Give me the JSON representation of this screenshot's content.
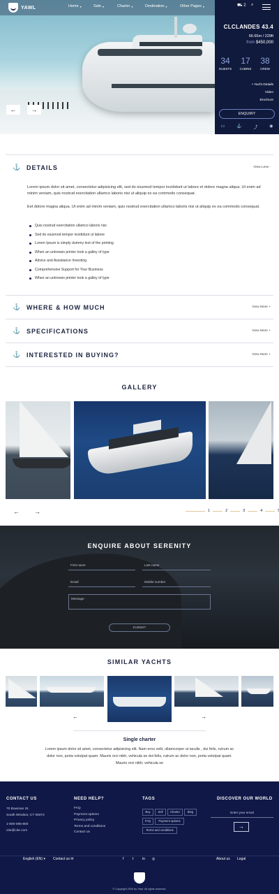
{
  "brand": {
    "name": "YAWL"
  },
  "nav": {
    "items": [
      {
        "label": "Home"
      },
      {
        "label": "Sale"
      },
      {
        "label": "Charter"
      },
      {
        "label": "Destination"
      },
      {
        "label": "Other Pages"
      }
    ],
    "cart_count": "2"
  },
  "hero_panel": {
    "title": "CLCLANDES 43.4",
    "dimensions": "66.65m / 229ft",
    "price_label": "from",
    "price": "$450,000",
    "stats": [
      {
        "value": "34",
        "label": "GUESTS"
      },
      {
        "value": "17",
        "label": "CABINS"
      },
      {
        "value": "38",
        "label": "CREW"
      }
    ],
    "links": [
      "• Yacht Details",
      "Video",
      "Brochure"
    ],
    "enquiry_label": "ENQUIRY"
  },
  "sections": {
    "details": {
      "title": "DETAILS",
      "toggle": "View Less -"
    },
    "where": {
      "title": "WHERE & HOW MUCH",
      "toggle": "View More +"
    },
    "specs": {
      "title": "SPECIFICATIONS",
      "toggle": "View More +"
    },
    "buying": {
      "title": "INTERESTED IN BUYING?",
      "toggle": "View More +"
    }
  },
  "details": {
    "paragraph1": "Lorem ipsum dolor sit amet, consectetur adipisicing elit, sed do eiusmod tempor incididunt ut labore et dolore magna aliqua. Ut enim ad minim veniam, quis nostrud exercitation ullamco laboris nisi ut aliquip ex ea commodo consequat.",
    "paragraph2": "Eet dolore magna aliqua. Ut enim ad minim veniam, quis nostrud exercitation ullamco laboris nisi ut aliquip ex ea commodo consequat.",
    "bullets": [
      "Quis nostrud exercitation ullamco laboris nisi",
      "Sed do eiusmod tempor incididunt ut labore",
      "Lorem Ipsum is simply dummy text of the printing",
      "When an unknown printer took a galley of type",
      "Advice and Assistance Investing",
      "Comprehensive Support for Your Business",
      "When an unknown printer took a galley of type"
    ]
  },
  "gallery": {
    "title": "GALLERY",
    "pages": [
      "1",
      "2",
      "3",
      "4",
      "5"
    ]
  },
  "enquire": {
    "title": "ENQUIRE ABOUT SERENITY",
    "first_name": "First name",
    "last_name": "Last name",
    "email": "Email",
    "mobile": "Mobile number",
    "message": "Message",
    "submit": "SUBMIT"
  },
  "similar": {
    "title": "SIMILAR YACHTS",
    "item_title": "Single charter",
    "item_desc": "Lorem ipsum dolor sit amet, consectetur adipisicing elit. Nam eros velit, ullamcorper ut iaculis , dui felis, rutrum ac dolor non, porta volutpat quam. Mauris orci nibh, vehicula se dui felis, rutrum ac dolor non, porta volutpat quam. Mauris orci nibh; vehicula se"
  },
  "footer": {
    "contact_title": "CONTACT US",
    "address1": "70 Bowman St.",
    "address2": "South Windsor, CT 06074",
    "phone": "1-800-085-800",
    "email": "cite@cite.com",
    "help_title": "NEED HELP?",
    "help_links": [
      "FAQ",
      "Payment options",
      "Privacy policy",
      "Terms and conditions",
      "Contact us"
    ],
    "tags_title": "TAGS",
    "tags": [
      "Buy",
      "Sell",
      "Charter",
      "Blog",
      "FAQ",
      "Payment options",
      "Terms and conditions"
    ],
    "discover_title": "DISCOVER OUR WORLD",
    "email_placeholder": "Enter your email",
    "language": "English (EN)",
    "contact_link": "Contact us",
    "about": "About us",
    "legal": "Legal",
    "copyright": "© Copyright 2020 by Yawl. All rights reserved."
  }
}
